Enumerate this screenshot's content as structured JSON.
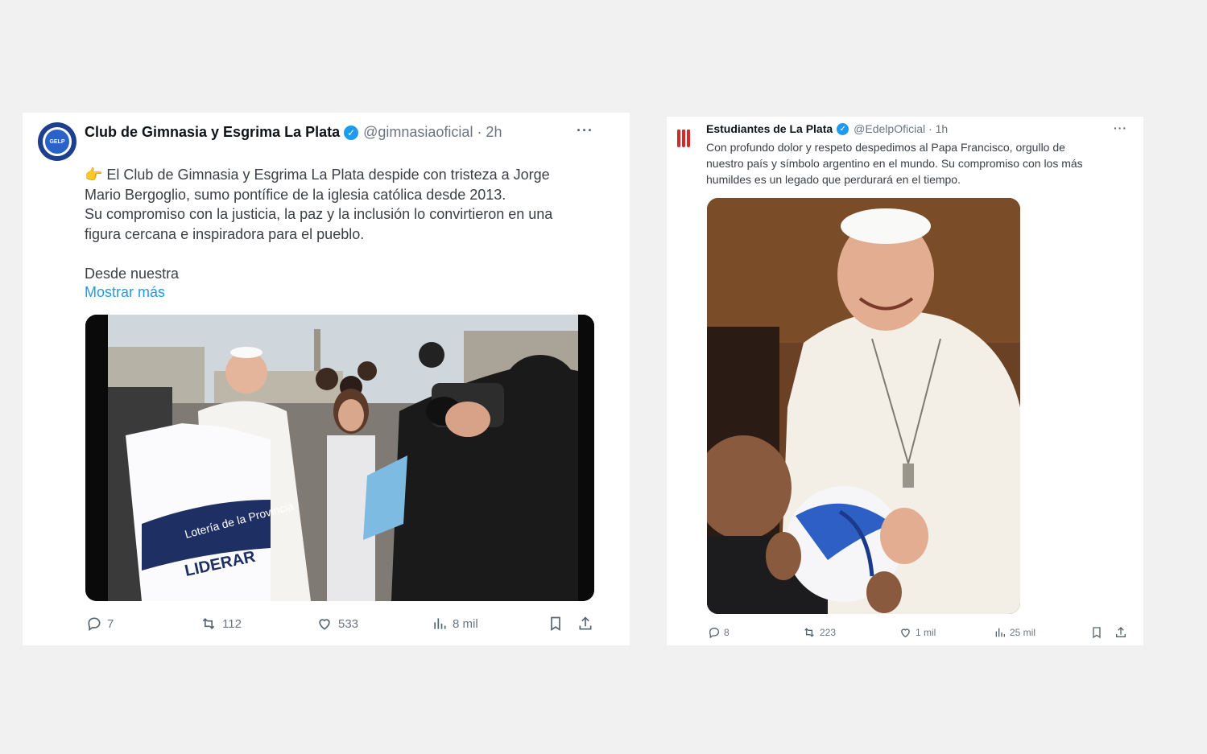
{
  "left_tweet": {
    "name": "Club de Gimnasia y Esgrima La Plata",
    "handle": "@gimnasiaoficial",
    "time": "· 2h",
    "more": "···",
    "avatar_text": "GELP",
    "text_p1": "El Club de Gimnasia y Esgrima La Plata despide con tristeza a Jorge\nMario Bergoglio, sumo pontífice de la iglesia católica desde 2013.",
    "text_p2": "Su compromiso con la justicia, la paz y la inclusión lo convirtieron en una\nfigura cercana e inspiradora para el pueblo.",
    "text_p3": "Desde nuestra",
    "show_more": "Mostrar más",
    "jersey_text_1": "Lotería de la Provincia",
    "jersey_text_2": "LIDERAR",
    "replies": "7",
    "retweets": "112",
    "likes": "533",
    "views": "8 mil"
  },
  "right_tweet": {
    "name": "Estudiantes de La Plata",
    "handle": "@EdelpOficial",
    "time": "· 1h",
    "more": "···",
    "text": "Con profundo dolor y respeto despedimos al Papa Francisco, orgullo de\nnuestro país y símbolo argentino en el mundo. Su compromiso con los más\nhumildes es un legado que perdurará en el tiempo.",
    "replies": "8",
    "retweets": "223",
    "likes": "1 mil",
    "views": "25 mil"
  },
  "colors": {
    "accent": "#1d9bf0",
    "muted": "#6b7580",
    "background": "#f1f1f1"
  }
}
